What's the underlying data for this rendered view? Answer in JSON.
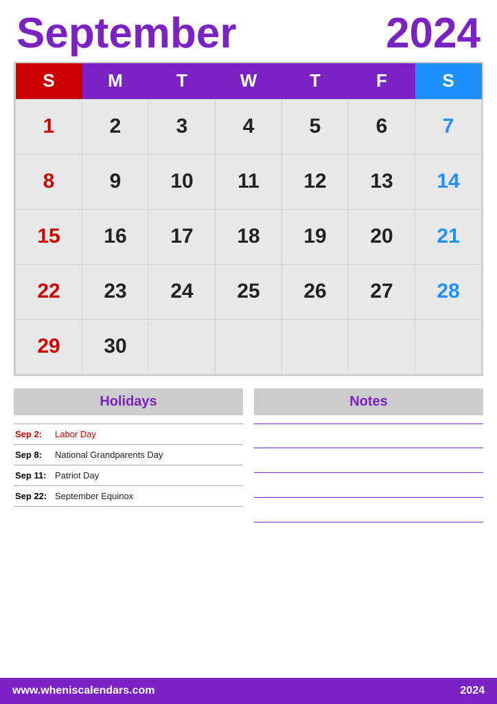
{
  "header": {
    "month": "September",
    "year": "2024"
  },
  "weekdays": [
    {
      "label": "S",
      "type": "sunday"
    },
    {
      "label": "M",
      "type": "weekday"
    },
    {
      "label": "T",
      "type": "weekday"
    },
    {
      "label": "W",
      "type": "weekday"
    },
    {
      "label": "T",
      "type": "weekday"
    },
    {
      "label": "F",
      "type": "weekday"
    },
    {
      "label": "S",
      "type": "saturday"
    }
  ],
  "calendar_rows": [
    [
      {
        "day": "",
        "type": "empty"
      },
      {
        "day": "2",
        "type": "weekday"
      },
      {
        "day": "3",
        "type": "weekday"
      },
      {
        "day": "4",
        "type": "weekday"
      },
      {
        "day": "5",
        "type": "weekday"
      },
      {
        "day": "6",
        "type": "weekday"
      },
      {
        "day": "7",
        "type": "saturday"
      }
    ],
    [
      {
        "day": "8",
        "type": "sunday"
      },
      {
        "day": "9",
        "type": "weekday"
      },
      {
        "day": "10",
        "type": "weekday"
      },
      {
        "day": "11",
        "type": "weekday"
      },
      {
        "day": "12",
        "type": "weekday"
      },
      {
        "day": "13",
        "type": "weekday"
      },
      {
        "day": "14",
        "type": "saturday"
      }
    ],
    [
      {
        "day": "15",
        "type": "sunday"
      },
      {
        "day": "16",
        "type": "weekday"
      },
      {
        "day": "17",
        "type": "weekday"
      },
      {
        "day": "18",
        "type": "weekday"
      },
      {
        "day": "19",
        "type": "weekday"
      },
      {
        "day": "20",
        "type": "weekday"
      },
      {
        "day": "21",
        "type": "saturday"
      }
    ],
    [
      {
        "day": "22",
        "type": "sunday"
      },
      {
        "day": "23",
        "type": "weekday"
      },
      {
        "day": "24",
        "type": "weekday"
      },
      {
        "day": "25",
        "type": "weekday"
      },
      {
        "day": "26",
        "type": "weekday"
      },
      {
        "day": "27",
        "type": "weekday"
      },
      {
        "day": "28",
        "type": "saturday"
      }
    ],
    [
      {
        "day": "29",
        "type": "sunday"
      },
      {
        "day": "30",
        "type": "weekday"
      },
      {
        "day": "",
        "type": "empty"
      },
      {
        "day": "",
        "type": "empty"
      },
      {
        "day": "",
        "type": "empty"
      },
      {
        "day": "",
        "type": "empty"
      },
      {
        "day": "",
        "type": "empty"
      }
    ]
  ],
  "first_row": [
    {
      "day": "1",
      "type": "sunday"
    },
    {
      "day": "2",
      "type": "weekday"
    },
    {
      "day": "3",
      "type": "weekday"
    },
    {
      "day": "4",
      "type": "weekday"
    },
    {
      "day": "5",
      "type": "weekday"
    },
    {
      "day": "6",
      "type": "weekday"
    },
    {
      "day": "7",
      "type": "saturday"
    }
  ],
  "holidays_label": "Holidays",
  "notes_label": "Notes",
  "holidays": [
    {
      "date": "Sep 2:",
      "name": "Labor Day",
      "highlight": true
    },
    {
      "date": "Sep 8:",
      "name": "National Grandparents Day",
      "highlight": false
    },
    {
      "date": "Sep 11:",
      "name": "Patriot Day",
      "highlight": false
    },
    {
      "date": "Sep 22:",
      "name": "September Equinox",
      "highlight": false
    }
  ],
  "note_lines": 4,
  "footer": {
    "website": "www.wheniscalendars.com",
    "year": "2024"
  }
}
